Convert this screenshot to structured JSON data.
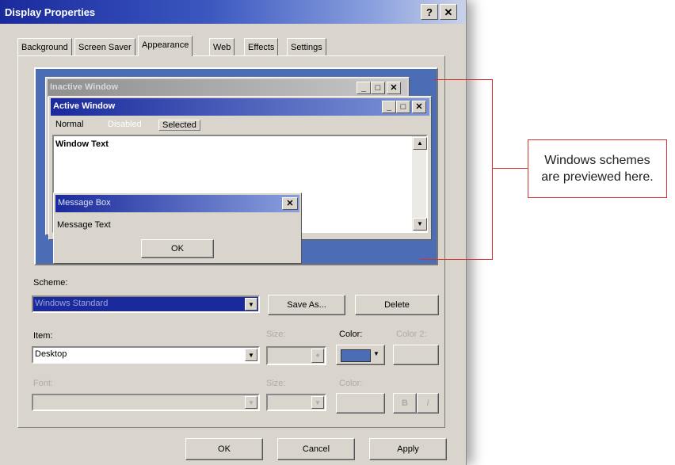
{
  "dialog": {
    "title": "Display Properties",
    "help_label": "?",
    "close_label": "✕"
  },
  "tabs": [
    {
      "label": "Background"
    },
    {
      "label": "Screen Saver"
    },
    {
      "label": "Appearance"
    },
    {
      "label": "Web"
    },
    {
      "label": "Effects"
    },
    {
      "label": "Settings"
    }
  ],
  "preview": {
    "inactive_title": "Inactive Window",
    "active_title": "Active Window",
    "menu": {
      "normal": "Normal",
      "disabled": "Disabled",
      "selected": "Selected"
    },
    "window_text": "Window Text",
    "message_box_title": "Message Box",
    "message_text": "Message Text",
    "ok_label": "OK",
    "min_glyph": "_",
    "max_glyph": "□",
    "close_glyph": "✕"
  },
  "scheme": {
    "label": "Scheme:",
    "value": "Windows Standard",
    "save_as_label": "Save As...",
    "delete_label": "Delete"
  },
  "item": {
    "label": "Item:",
    "value": "Desktop",
    "size_label": "Size:",
    "color_label": "Color:",
    "color2_label": "Color 2:"
  },
  "font": {
    "label": "Font:",
    "size_label": "Size:",
    "color_label": "Color:",
    "bold_label": "B",
    "italic_label": "I"
  },
  "footer": {
    "ok_label": "OK",
    "cancel_label": "Cancel",
    "apply_label": "Apply"
  },
  "callout": {
    "line1": "Windows schemes",
    "line2": "are previewed here."
  },
  "colors": {
    "desktop_blue": "#4b6db5",
    "selection_blue": "#1a2a9c",
    "callout_red": "#d83030"
  }
}
